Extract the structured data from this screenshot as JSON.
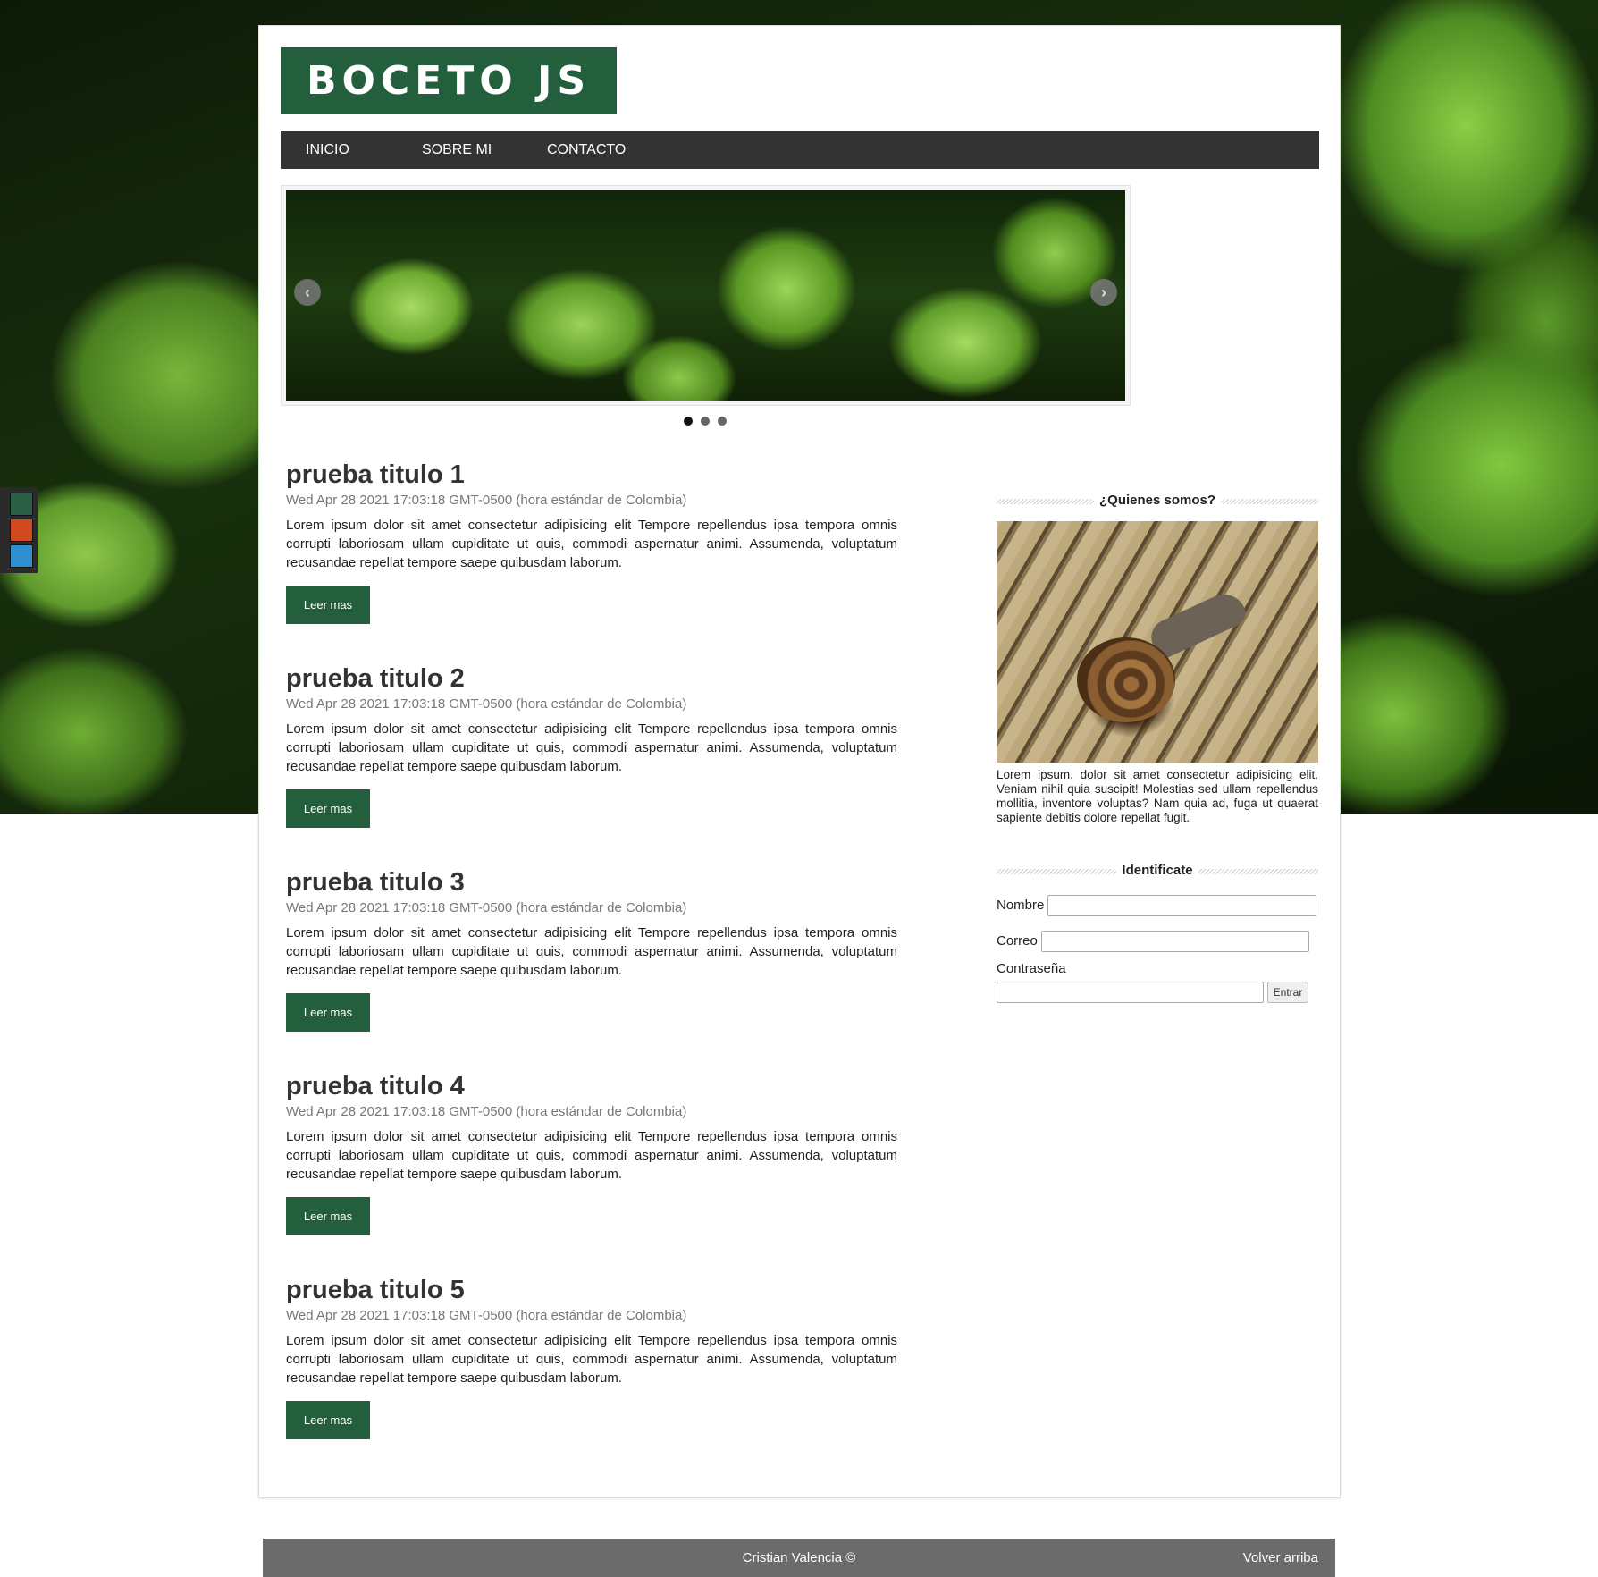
{
  "colors": {
    "brand": "#235e3d",
    "nav_bg": "#333333",
    "footer_bg": "#6b6b6b",
    "theme_swatches": [
      "#2b5f45",
      "#d24a1f",
      "#2f8fd0"
    ]
  },
  "site": {
    "logo": "BOCETO JS"
  },
  "nav": {
    "items": [
      "INICIO",
      "SOBRE MI",
      "CONTACTO"
    ]
  },
  "slider": {
    "prev_icon": "‹",
    "next_icon": "›",
    "slides": 3,
    "active_slide": 1
  },
  "posts": [
    {
      "title": "prueba titulo 1",
      "date": "Wed Apr 28 2021 17:03:18 GMT-0500 (hora estándar de Colombia)",
      "text": "Lorem ipsum dolor sit amet consectetur adipisicing elit Tempore repellendus ipsa tempora omnis corrupti laboriosam ullam cupiditate ut quis, commodi aspernatur animi. Assumenda, voluptatum recusandae repellat tempore saepe quibusdam laborum.",
      "button": "Leer mas"
    },
    {
      "title": "prueba titulo 2",
      "date": "Wed Apr 28 2021 17:03:18 GMT-0500 (hora estándar de Colombia)",
      "text": "Lorem ipsum dolor sit amet consectetur adipisicing elit Tempore repellendus ipsa tempora omnis corrupti laboriosam ullam cupiditate ut quis, commodi aspernatur animi. Assumenda, voluptatum recusandae repellat tempore saepe quibusdam laborum.",
      "button": "Leer mas"
    },
    {
      "title": "prueba titulo 3",
      "date": "Wed Apr 28 2021 17:03:18 GMT-0500 (hora estándar de Colombia)",
      "text": "Lorem ipsum dolor sit amet consectetur adipisicing elit Tempore repellendus ipsa tempora omnis corrupti laboriosam ullam cupiditate ut quis, commodi aspernatur animi. Assumenda, voluptatum recusandae repellat tempore saepe quibusdam laborum.",
      "button": "Leer mas"
    },
    {
      "title": "prueba titulo 4",
      "date": "Wed Apr 28 2021 17:03:18 GMT-0500 (hora estándar de Colombia)",
      "text": "Lorem ipsum dolor sit amet consectetur adipisicing elit Tempore repellendus ipsa tempora omnis corrupti laboriosam ullam cupiditate ut quis, commodi aspernatur animi. Assumenda, voluptatum recusandae repellat tempore saepe quibusdam laborum.",
      "button": "Leer mas"
    },
    {
      "title": "prueba titulo 5",
      "date": "Wed Apr 28 2021 17:03:18 GMT-0500 (hora estándar de Colombia)",
      "text": "Lorem ipsum dolor sit amet consectetur adipisicing elit Tempore repellendus ipsa tempora omnis corrupti laboriosam ullam cupiditate ut quis, commodi aspernatur animi. Assumenda, voluptatum recusandae repellat tempore saepe quibusdam laborum.",
      "button": "Leer mas"
    }
  ],
  "sidebar": {
    "about_title": "¿Quienes somos?",
    "about_text": "Lorem ipsum, dolor sit amet consectetur adipisicing elit. Veniam nihil quia suscipit! Molestias sed ullam repellendus mollitia, inventore voluptas? Nam quia ad, fuga ut quaerat sapiente debitis dolore repellat fugit.",
    "login_title": "Identificate",
    "name_label": "Nombre",
    "email_label": "Correo",
    "password_label": "Contraseña",
    "name_value": "",
    "email_value": "",
    "password_value": "",
    "submit_label": "Entrar"
  },
  "footer": {
    "copyright": "Cristian Valencia ©",
    "back_to_top": "Volver arriba"
  }
}
